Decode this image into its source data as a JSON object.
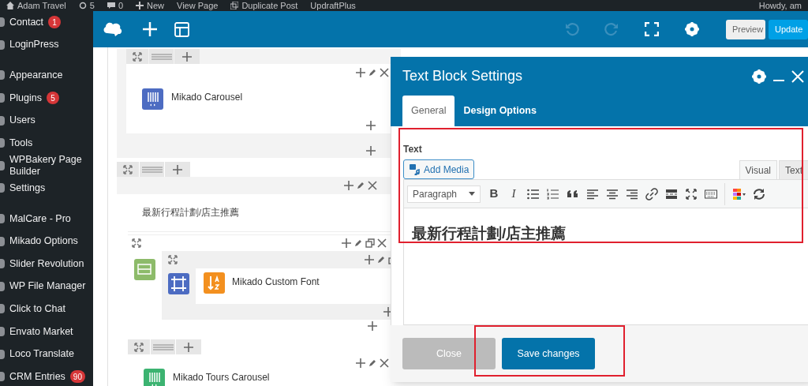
{
  "admin_bar": {
    "site": "Adam Travel",
    "updates": "5",
    "comments": "0",
    "new": "New",
    "links": [
      "View Page",
      "Duplicate Post",
      "UpdraftPlus"
    ],
    "greeting": "Howdy, am"
  },
  "sidebar": {
    "groups": [
      {
        "items": [
          {
            "label": "Contact",
            "badge": "1"
          },
          {
            "label": "LoginPress"
          }
        ]
      },
      {
        "items": [
          {
            "label": "Appearance"
          },
          {
            "label": "Plugins",
            "badge": "5"
          },
          {
            "label": "Users"
          },
          {
            "label": "Tools"
          },
          {
            "label": "WPBakery Page Builder"
          },
          {
            "label": "Settings"
          }
        ]
      },
      {
        "items": [
          {
            "label": "MalCare - Pro"
          },
          {
            "label": "Mikado Options"
          },
          {
            "label": "Slider Revolution"
          },
          {
            "label": "WP File Manager"
          },
          {
            "label": "Click to Chat"
          },
          {
            "label": "Envato Market"
          },
          {
            "label": "Loco Translate"
          },
          {
            "label": "CRM Entries",
            "badge": "90"
          }
        ]
      }
    ]
  },
  "builder_toolbar": {
    "buttons": [
      {
        "label": "Preview",
        "kind": "secondary"
      },
      {
        "label": "Update",
        "kind": "primary"
      }
    ]
  },
  "canvas": {
    "rows": [
      {
        "elements": [
          {
            "kind": "widget",
            "label": "Mikado Carousel",
            "color": "#4d6cc2"
          }
        ]
      },
      {
        "elements": [
          {
            "kind": "text",
            "label": "最新行程計劃/店主推薦"
          },
          {
            "kind": "inner_row",
            "color": "#8dbb6a",
            "children": [
              {
                "kind": "widget",
                "label": "Mikado Custom Font",
                "color": "#f3901f"
              }
            ]
          }
        ]
      },
      {
        "elements": [
          {
            "kind": "widget",
            "label": "Mikado Tours Carousel",
            "color": "#3cb371"
          }
        ]
      }
    ]
  },
  "modal": {
    "title": "Text Block Settings",
    "tabs": [
      {
        "label": "General",
        "selected": true
      },
      {
        "label": "Design Options",
        "selected": false
      }
    ],
    "field_label": "Text",
    "add_media": "Add Media",
    "editor_tabs": [
      {
        "label": "Visual",
        "selected": true
      },
      {
        "label": "Text",
        "selected": false
      }
    ],
    "format_select": "Paragraph",
    "toolbar": [
      {
        "kind": "bold",
        "label": "B"
      },
      {
        "kind": "italic",
        "label": "I"
      },
      {
        "kind": "bullets"
      },
      {
        "kind": "numbers"
      },
      {
        "kind": "quote"
      },
      {
        "kind": "align-left"
      },
      {
        "kind": "align-center"
      },
      {
        "kind": "align-right"
      },
      {
        "kind": "link"
      },
      {
        "kind": "more"
      },
      {
        "kind": "fullscreen"
      },
      {
        "kind": "keyboard"
      },
      {
        "kind": "colors"
      },
      {
        "kind": "refresh"
      }
    ],
    "content": "最新行程計劃/店主推薦",
    "buttons": [
      {
        "label": "Close",
        "kind": "secondary"
      },
      {
        "label": "Save changes",
        "kind": "primary"
      }
    ]
  }
}
